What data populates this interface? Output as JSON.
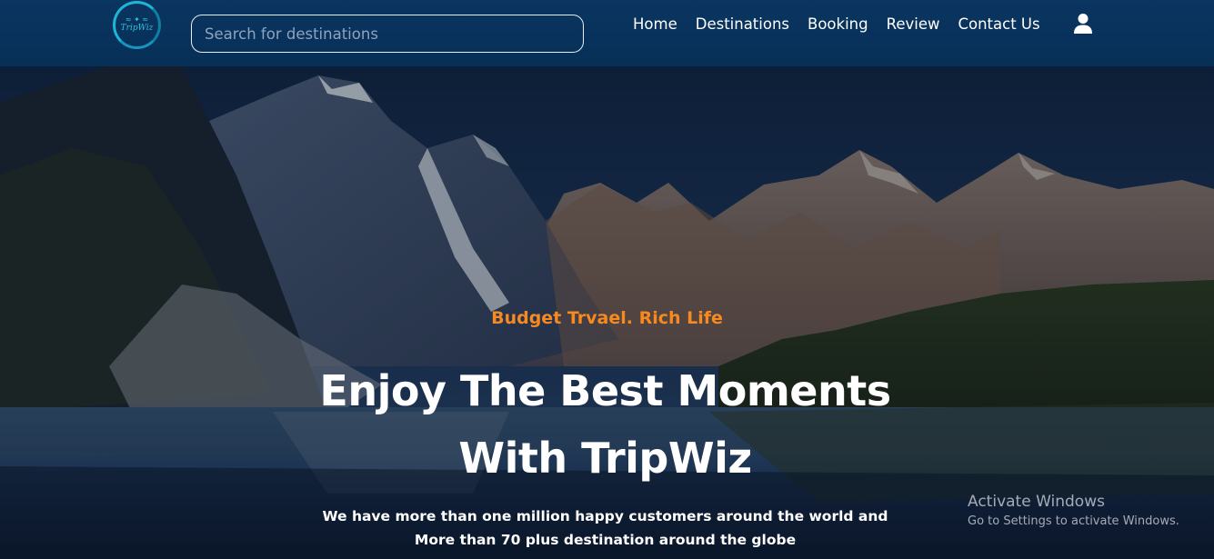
{
  "brand": {
    "logo_text": "TripWiz",
    "logo_mark": "≈ ✦ ≈"
  },
  "search": {
    "placeholder": "Search for destinations",
    "value": ""
  },
  "nav": {
    "items": [
      {
        "label": "Home"
      },
      {
        "label": "Destinations"
      },
      {
        "label": "Booking"
      },
      {
        "label": "Review"
      },
      {
        "label": "Contact Us"
      }
    ],
    "user_icon": "user-icon"
  },
  "hero": {
    "tagline": "Budget Trvael. Rich Life",
    "headline_line1": "Enjoy The Best Moments",
    "headline_line2": "With TripWiz",
    "subtext_line1": "We have more than one million happy customers around the world and",
    "subtext_line2": "More than 70 plus destination around the globe"
  },
  "watermark": {
    "title": "Activate Windows",
    "subtitle": "Go to Settings to activate Windows."
  },
  "colors": {
    "navbar": "#073058",
    "accent_orange": "#f6891f",
    "logo_teal": "#1bb8d6",
    "text_white": "#ffffff"
  }
}
